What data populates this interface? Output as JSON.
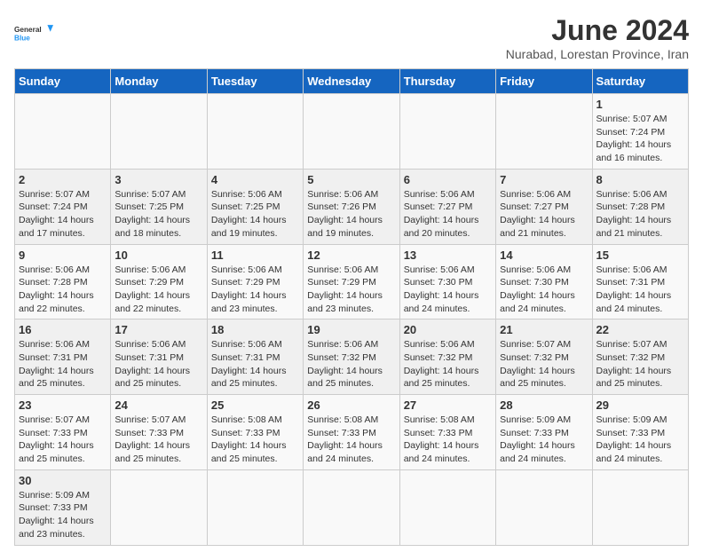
{
  "logo": {
    "text_general": "General",
    "text_blue": "Blue"
  },
  "title": {
    "month_year": "June 2024",
    "location": "Nurabad, Lorestan Province, Iran"
  },
  "weekdays": [
    "Sunday",
    "Monday",
    "Tuesday",
    "Wednesday",
    "Thursday",
    "Friday",
    "Saturday"
  ],
  "weeks": [
    [
      {
        "day": "",
        "sunrise": "",
        "sunset": "",
        "daylight": ""
      },
      {
        "day": "",
        "sunrise": "",
        "sunset": "",
        "daylight": ""
      },
      {
        "day": "",
        "sunrise": "",
        "sunset": "",
        "daylight": ""
      },
      {
        "day": "",
        "sunrise": "",
        "sunset": "",
        "daylight": ""
      },
      {
        "day": "",
        "sunrise": "",
        "sunset": "",
        "daylight": ""
      },
      {
        "day": "",
        "sunrise": "",
        "sunset": "",
        "daylight": ""
      },
      {
        "day": "1",
        "sunrise": "Sunrise: 5:07 AM",
        "sunset": "Sunset: 7:24 PM",
        "daylight": "Daylight: 14 hours and 16 minutes."
      }
    ],
    [
      {
        "day": "2",
        "sunrise": "Sunrise: 5:07 AM",
        "sunset": "Sunset: 7:24 PM",
        "daylight": "Daylight: 14 hours and 17 minutes."
      },
      {
        "day": "3",
        "sunrise": "Sunrise: 5:07 AM",
        "sunset": "Sunset: 7:25 PM",
        "daylight": "Daylight: 14 hours and 18 minutes."
      },
      {
        "day": "4",
        "sunrise": "Sunrise: 5:06 AM",
        "sunset": "Sunset: 7:25 PM",
        "daylight": "Daylight: 14 hours and 19 minutes."
      },
      {
        "day": "5",
        "sunrise": "Sunrise: 5:06 AM",
        "sunset": "Sunset: 7:26 PM",
        "daylight": "Daylight: 14 hours and 19 minutes."
      },
      {
        "day": "6",
        "sunrise": "Sunrise: 5:06 AM",
        "sunset": "Sunset: 7:27 PM",
        "daylight": "Daylight: 14 hours and 20 minutes."
      },
      {
        "day": "7",
        "sunrise": "Sunrise: 5:06 AM",
        "sunset": "Sunset: 7:27 PM",
        "daylight": "Daylight: 14 hours and 21 minutes."
      },
      {
        "day": "8",
        "sunrise": "Sunrise: 5:06 AM",
        "sunset": "Sunset: 7:28 PM",
        "daylight": "Daylight: 14 hours and 21 minutes."
      }
    ],
    [
      {
        "day": "9",
        "sunrise": "Sunrise: 5:06 AM",
        "sunset": "Sunset: 7:28 PM",
        "daylight": "Daylight: 14 hours and 22 minutes."
      },
      {
        "day": "10",
        "sunrise": "Sunrise: 5:06 AM",
        "sunset": "Sunset: 7:29 PM",
        "daylight": "Daylight: 14 hours and 22 minutes."
      },
      {
        "day": "11",
        "sunrise": "Sunrise: 5:06 AM",
        "sunset": "Sunset: 7:29 PM",
        "daylight": "Daylight: 14 hours and 23 minutes."
      },
      {
        "day": "12",
        "sunrise": "Sunrise: 5:06 AM",
        "sunset": "Sunset: 7:29 PM",
        "daylight": "Daylight: 14 hours and 23 minutes."
      },
      {
        "day": "13",
        "sunrise": "Sunrise: 5:06 AM",
        "sunset": "Sunset: 7:30 PM",
        "daylight": "Daylight: 14 hours and 24 minutes."
      },
      {
        "day": "14",
        "sunrise": "Sunrise: 5:06 AM",
        "sunset": "Sunset: 7:30 PM",
        "daylight": "Daylight: 14 hours and 24 minutes."
      },
      {
        "day": "15",
        "sunrise": "Sunrise: 5:06 AM",
        "sunset": "Sunset: 7:31 PM",
        "daylight": "Daylight: 14 hours and 24 minutes."
      }
    ],
    [
      {
        "day": "16",
        "sunrise": "Sunrise: 5:06 AM",
        "sunset": "Sunset: 7:31 PM",
        "daylight": "Daylight: 14 hours and 25 minutes."
      },
      {
        "day": "17",
        "sunrise": "Sunrise: 5:06 AM",
        "sunset": "Sunset: 7:31 PM",
        "daylight": "Daylight: 14 hours and 25 minutes."
      },
      {
        "day": "18",
        "sunrise": "Sunrise: 5:06 AM",
        "sunset": "Sunset: 7:31 PM",
        "daylight": "Daylight: 14 hours and 25 minutes."
      },
      {
        "day": "19",
        "sunrise": "Sunrise: 5:06 AM",
        "sunset": "Sunset: 7:32 PM",
        "daylight": "Daylight: 14 hours and 25 minutes."
      },
      {
        "day": "20",
        "sunrise": "Sunrise: 5:06 AM",
        "sunset": "Sunset: 7:32 PM",
        "daylight": "Daylight: 14 hours and 25 minutes."
      },
      {
        "day": "21",
        "sunrise": "Sunrise: 5:07 AM",
        "sunset": "Sunset: 7:32 PM",
        "daylight": "Daylight: 14 hours and 25 minutes."
      },
      {
        "day": "22",
        "sunrise": "Sunrise: 5:07 AM",
        "sunset": "Sunset: 7:32 PM",
        "daylight": "Daylight: 14 hours and 25 minutes."
      }
    ],
    [
      {
        "day": "23",
        "sunrise": "Sunrise: 5:07 AM",
        "sunset": "Sunset: 7:33 PM",
        "daylight": "Daylight: 14 hours and 25 minutes."
      },
      {
        "day": "24",
        "sunrise": "Sunrise: 5:07 AM",
        "sunset": "Sunset: 7:33 PM",
        "daylight": "Daylight: 14 hours and 25 minutes."
      },
      {
        "day": "25",
        "sunrise": "Sunrise: 5:08 AM",
        "sunset": "Sunset: 7:33 PM",
        "daylight": "Daylight: 14 hours and 25 minutes."
      },
      {
        "day": "26",
        "sunrise": "Sunrise: 5:08 AM",
        "sunset": "Sunset: 7:33 PM",
        "daylight": "Daylight: 14 hours and 24 minutes."
      },
      {
        "day": "27",
        "sunrise": "Sunrise: 5:08 AM",
        "sunset": "Sunset: 7:33 PM",
        "daylight": "Daylight: 14 hours and 24 minutes."
      },
      {
        "day": "28",
        "sunrise": "Sunrise: 5:09 AM",
        "sunset": "Sunset: 7:33 PM",
        "daylight": "Daylight: 14 hours and 24 minutes."
      },
      {
        "day": "29",
        "sunrise": "Sunrise: 5:09 AM",
        "sunset": "Sunset: 7:33 PM",
        "daylight": "Daylight: 14 hours and 24 minutes."
      }
    ],
    [
      {
        "day": "30",
        "sunrise": "Sunrise: 5:09 AM",
        "sunset": "Sunset: 7:33 PM",
        "daylight": "Daylight: 14 hours and 23 minutes."
      },
      {
        "day": "",
        "sunrise": "",
        "sunset": "",
        "daylight": ""
      },
      {
        "day": "",
        "sunrise": "",
        "sunset": "",
        "daylight": ""
      },
      {
        "day": "",
        "sunrise": "",
        "sunset": "",
        "daylight": ""
      },
      {
        "day": "",
        "sunrise": "",
        "sunset": "",
        "daylight": ""
      },
      {
        "day": "",
        "sunrise": "",
        "sunset": "",
        "daylight": ""
      },
      {
        "day": "",
        "sunrise": "",
        "sunset": "",
        "daylight": ""
      }
    ]
  ]
}
